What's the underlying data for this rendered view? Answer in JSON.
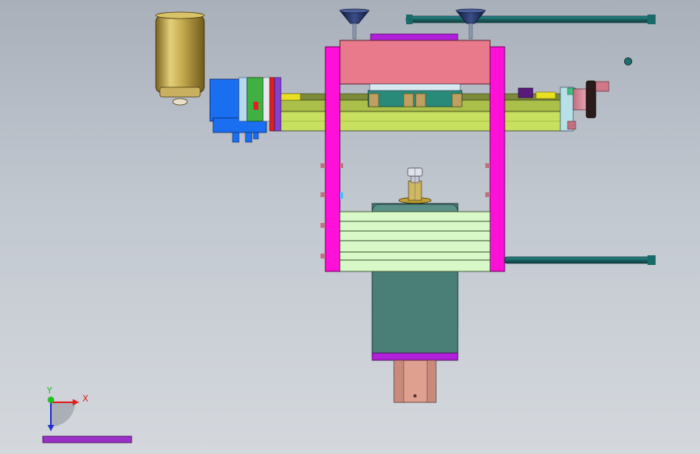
{
  "viewport": {
    "background_top": "#a9b0ba",
    "background_bottom": "#d4d8dd"
  },
  "triad": {
    "x_label": "X",
    "y_label": "Y",
    "x_color": "#e02020",
    "y_color": "#20c020",
    "z_color": "#2030d0"
  },
  "colors": {
    "magenta_frame": "#ff10d8",
    "top_plate": "#e87a8c",
    "rail_green": "#c8e060",
    "motor_blue": "#1a6ef0",
    "motor_green": "#40b040",
    "press_body": "#4a7f78",
    "stack_plate": "#d8f8c8",
    "teal_pipe": "#1e7070",
    "funnel_navy": "#1a2a5a",
    "canister_gold": "#b8a04a",
    "purple_base": "#b020d8",
    "ground_plane": "#9b30c8"
  }
}
